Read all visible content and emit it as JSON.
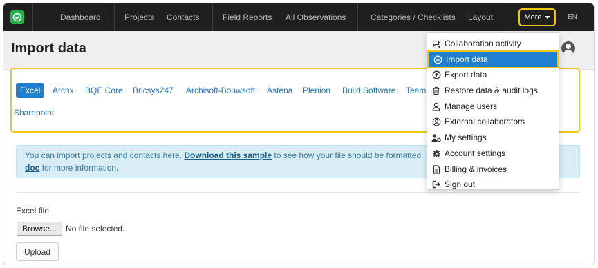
{
  "nav": {
    "items": [
      "Dashboard",
      "Projects",
      "Contacts",
      "Field Reports",
      "All Observations",
      "Categories / Checklists",
      "Layout"
    ],
    "more_label": "More",
    "lang": "EN",
    "brand_color": "#24b24b"
  },
  "header": {
    "title": "Import data"
  },
  "import_tabs": {
    "items": [
      "Excel",
      "Archx",
      "BQE Core",
      "Bricsys247",
      "Archisoft-Bouwsoft",
      "Astena",
      "Plenion",
      "Build Software",
      "Team",
      "Sharepoint"
    ],
    "active": "Excel"
  },
  "info": {
    "text_before": "You can import projects and contacts here. ",
    "link": "Download this sample",
    "text_after": " to see how your file should be formatted",
    "link2": "doc",
    "text_end": " for more information."
  },
  "upload_form": {
    "file_label": "Excel file",
    "browse_label": "Browse...",
    "no_file_text": "No file selected.",
    "upload_label": "Upload"
  },
  "dropdown": {
    "items": [
      {
        "label": "Collaboration activity",
        "icon": "chat-icon"
      },
      {
        "label": "Import data",
        "icon": "arrow-circle-down-icon"
      },
      {
        "label": "Export data",
        "icon": "arrow-circle-up-icon"
      },
      {
        "label": "Restore data & audit logs",
        "icon": "trash-icon"
      },
      {
        "label": "Manage users",
        "icon": "user-icon"
      },
      {
        "label": "External collaborators",
        "icon": "user-circle-icon"
      },
      {
        "label": "My settings",
        "icon": "user-gear-icon"
      },
      {
        "label": "Account settings",
        "icon": "gear-icon"
      },
      {
        "label": "Billing & invoices",
        "icon": "document-icon"
      },
      {
        "label": "Sign out",
        "icon": "sign-out-icon"
      }
    ],
    "active": "Import data"
  },
  "colors": {
    "highlight": "#f0c419",
    "accent": "#1f7fd1",
    "info_bg": "#d9edf7"
  }
}
